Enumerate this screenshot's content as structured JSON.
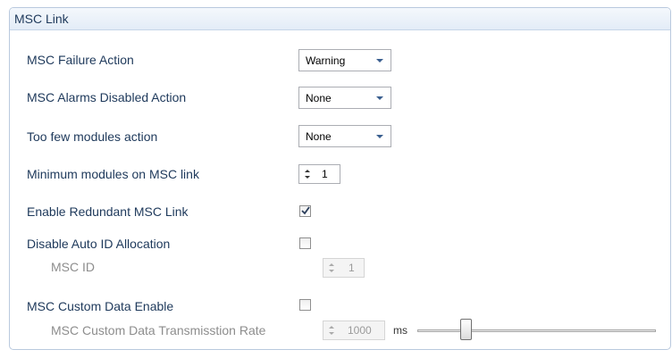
{
  "panel": {
    "title": "MSC Link"
  },
  "fields": {
    "failure_action": {
      "label": "MSC Failure Action",
      "value": "Warning"
    },
    "alarms_disabled_action": {
      "label": "MSC Alarms Disabled Action",
      "value": "None"
    },
    "too_few_modules_action": {
      "label": "Too few modules action",
      "value": "None"
    },
    "minimum_modules": {
      "label": "Minimum modules on MSC link",
      "value": "1"
    },
    "enable_redundant": {
      "label": "Enable Redundant MSC Link",
      "checked": true
    },
    "disable_auto_id": {
      "label": "Disable Auto ID Allocation",
      "checked": false
    },
    "msc_id": {
      "label": "MSC ID",
      "value": "1"
    },
    "custom_data_enable": {
      "label": "MSC Custom Data Enable",
      "checked": false
    },
    "custom_data_rate": {
      "label": "MSC Custom Data Transmisstion Rate",
      "value": "1000",
      "unit": "ms",
      "slider_fraction": 0.19
    }
  },
  "colors": {
    "label": "#1e395b",
    "disabled_label": "#8d8d8d",
    "header_bg": "#e3ecf7",
    "border": "#b9c9de"
  }
}
